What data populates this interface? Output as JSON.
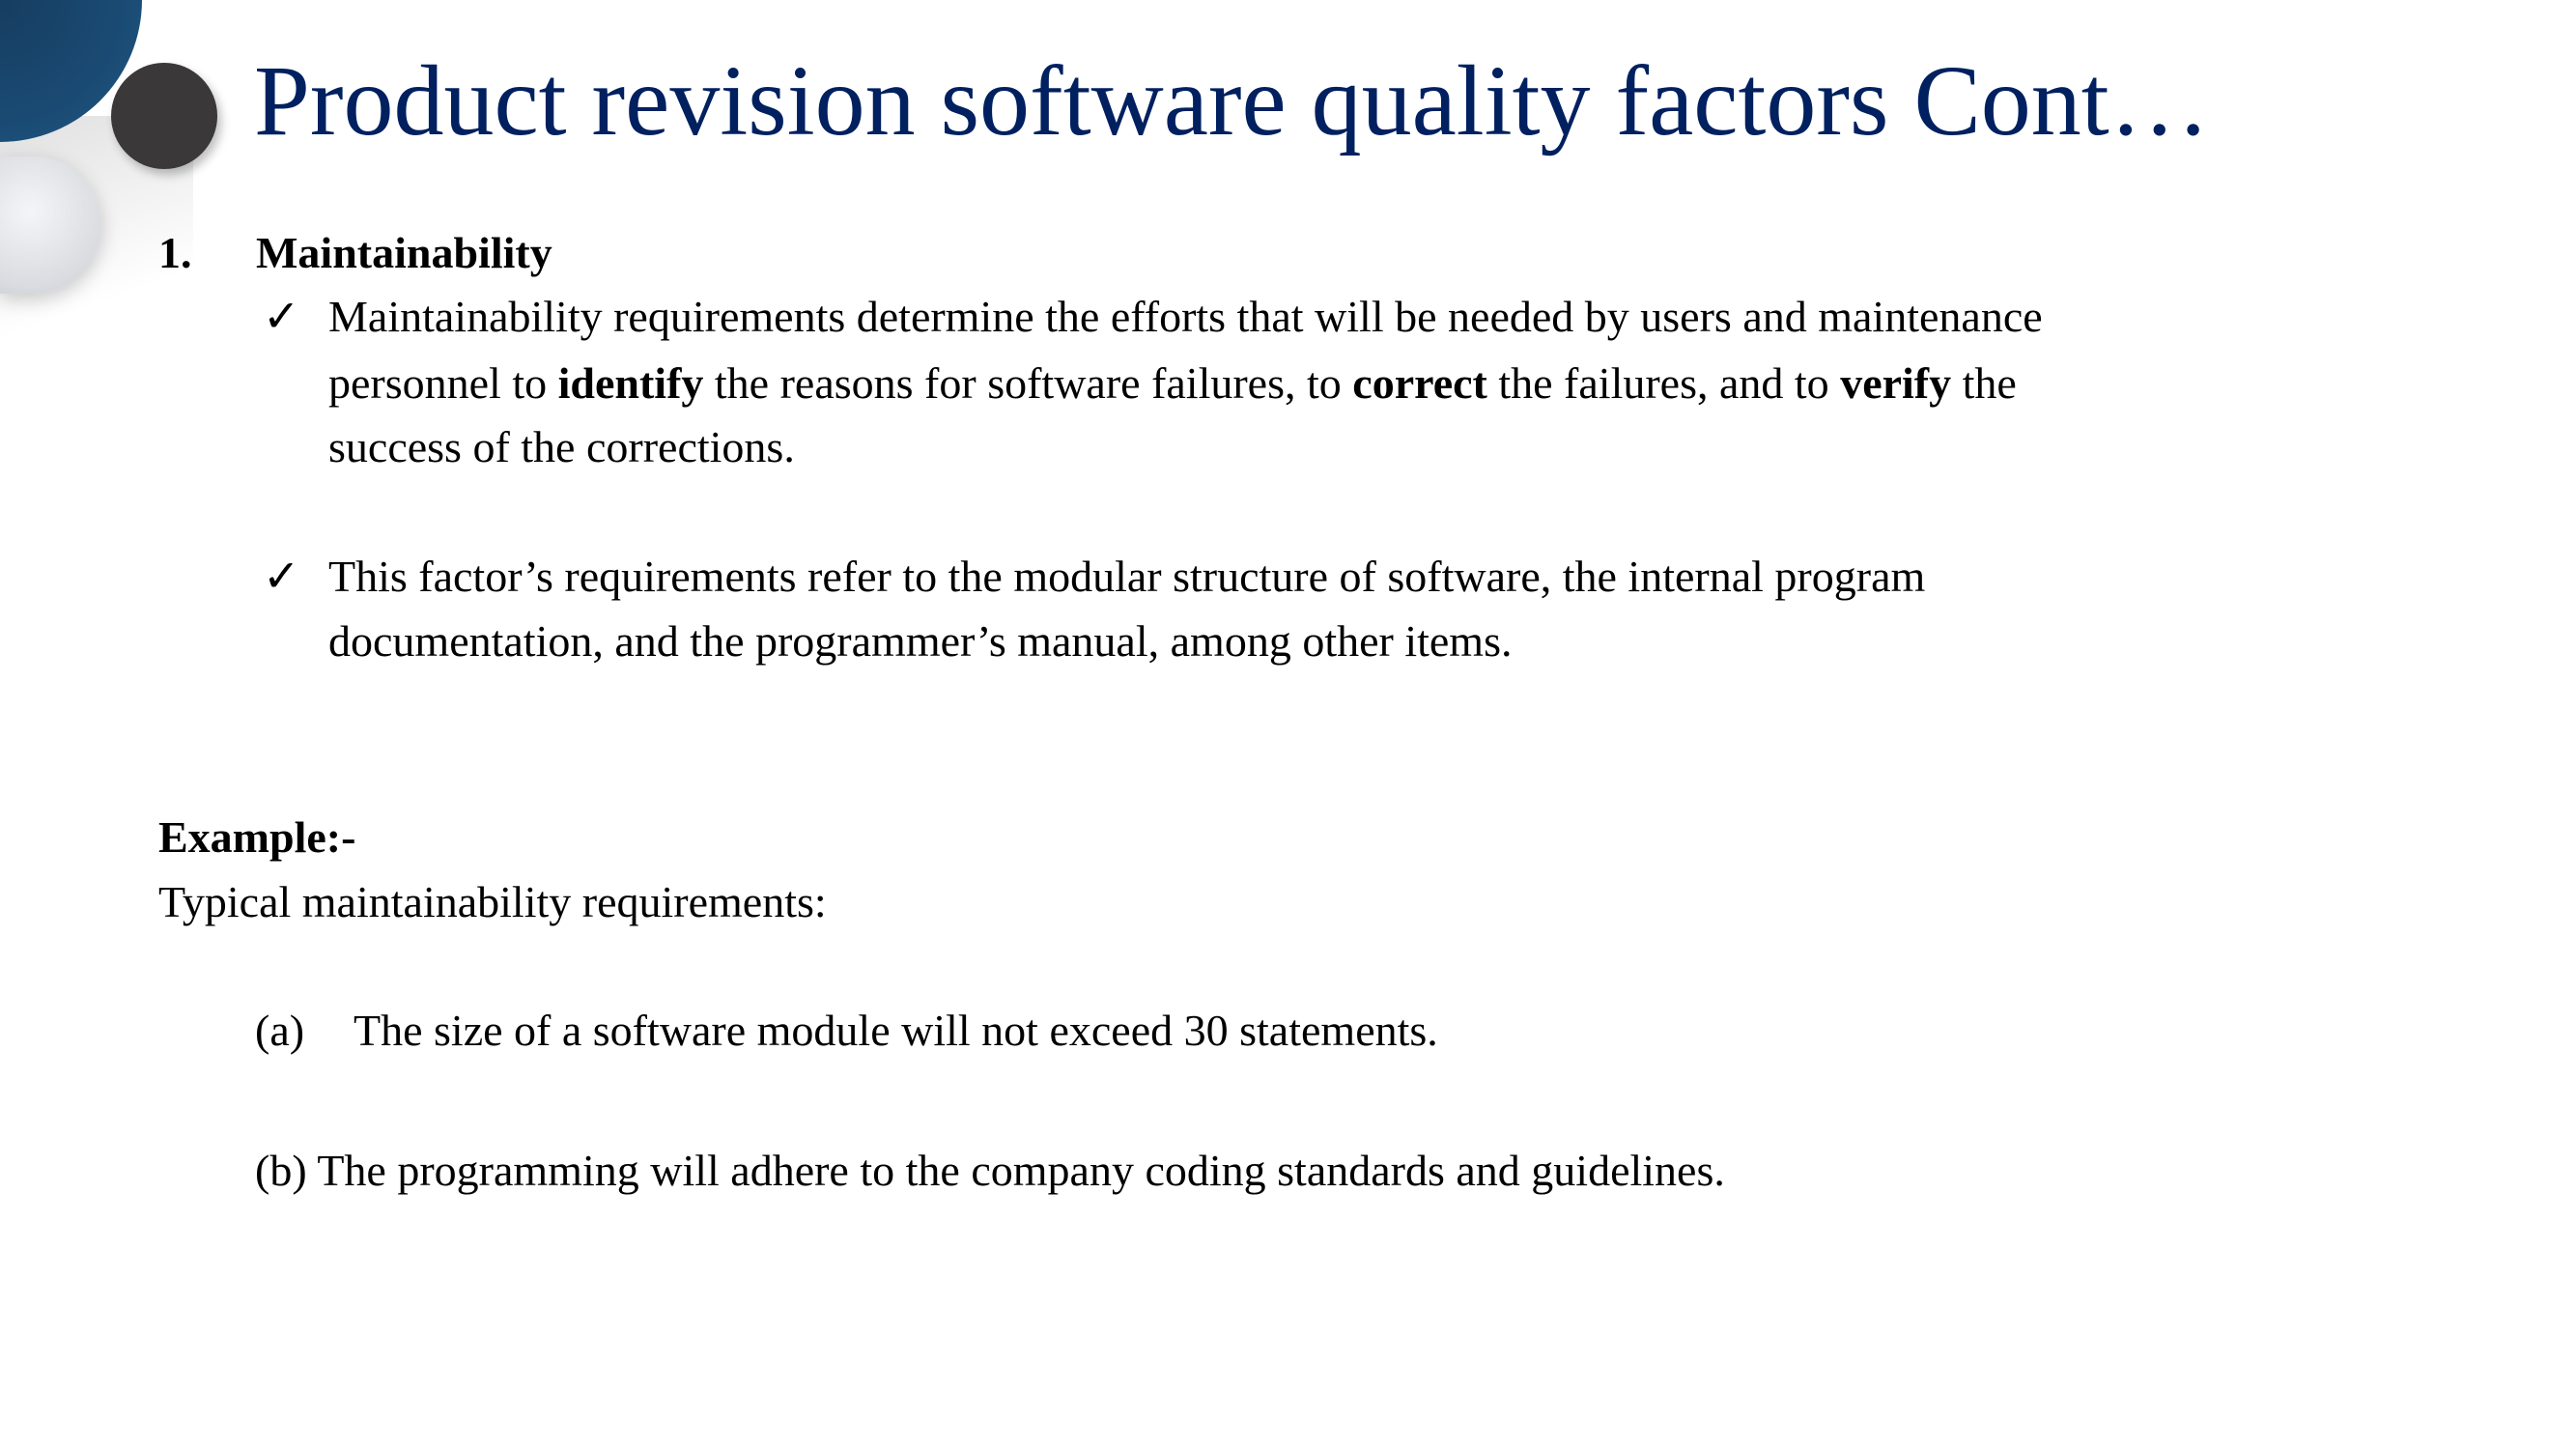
{
  "title": "Product revision software quality factors Cont…",
  "section": {
    "number": "1.",
    "heading": "Maintainability"
  },
  "bullets": [
    {
      "icon": "checkmark-icon",
      "lines": [
        [
          "Maintainability requirements determine the efforts that will be needed by users and maintenance"
        ],
        [
          "personnel to ",
          "identify",
          " the reasons for software failures, to ",
          "correct",
          " the failures, and to ",
          "verify",
          " the"
        ],
        [
          "success of the corrections."
        ]
      ]
    },
    {
      "icon": "checkmark-icon",
      "lines": [
        [
          "This factor’s requirements refer to the modular structure of software, the internal program"
        ],
        [
          "documentation, and the programmer’s manual, among other items."
        ]
      ]
    }
  ],
  "example": {
    "heading": "Example:-",
    "intro": "Typical maintainability requirements:",
    "items": [
      {
        "label": "(a)",
        "text": "The size of a software module will not exceed 30 statements."
      },
      {
        "label": "(b)",
        "text": "The programming will adhere to the company coding standards and guidelines."
      }
    ]
  },
  "check_glyph": "✓",
  "colors": {
    "title": "#002060",
    "blue_circle": "#1a4a73",
    "dark_circle": "#3a3839"
  }
}
